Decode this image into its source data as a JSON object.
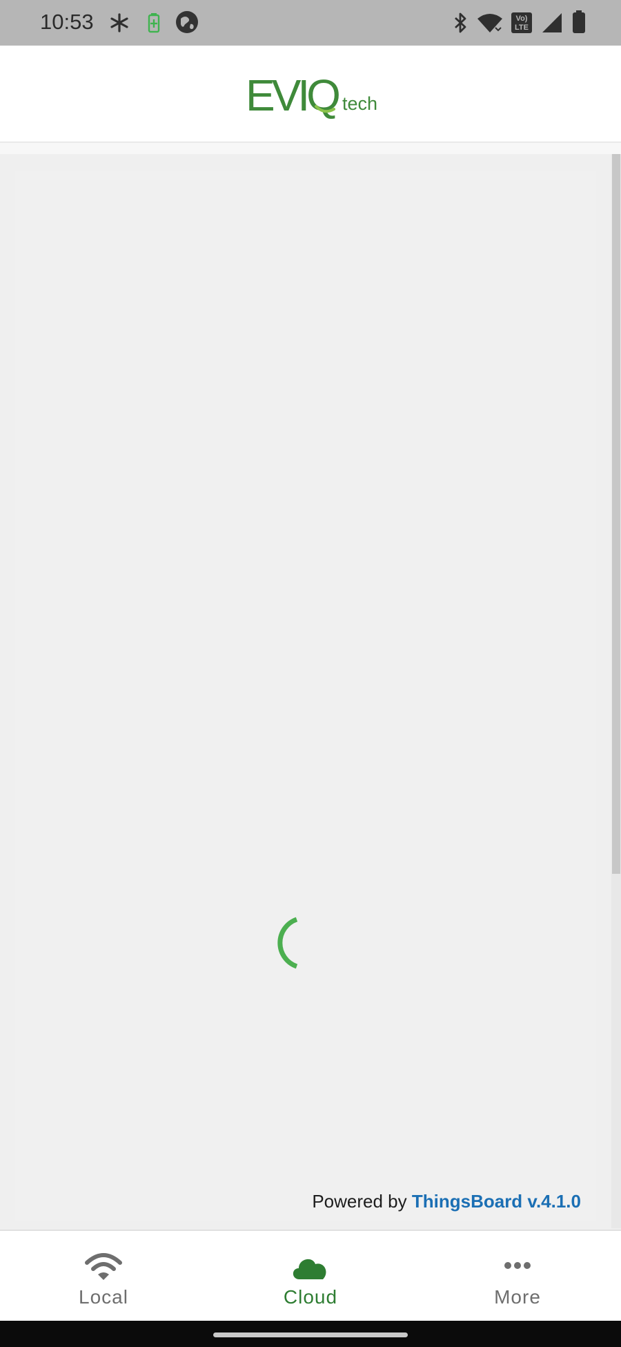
{
  "status_bar": {
    "time": "10:53",
    "left_icons": [
      "fan-icon",
      "battery-saver-icon",
      "vpn-globe-icon"
    ],
    "right_icons": [
      "bluetooth-icon",
      "wifi-icon",
      "volte-icon",
      "cell-signal-icon",
      "battery-icon"
    ],
    "volte_label_top": "Vo)",
    "volte_label_bottom": "LTE"
  },
  "header": {
    "logo_main": "EVIQ",
    "logo_sub": "tech",
    "brand_color": "#3f8a3a"
  },
  "content": {
    "loading_spinner": "spinner-icon",
    "spinner_color": "#4caf50",
    "powered_by_prefix": "Powered by ",
    "powered_by_link": "ThingsBoard v.4.1.0",
    "link_color": "#1b6fb4"
  },
  "bottom_nav": {
    "items": [
      {
        "label": "Local",
        "icon": "wifi-icon",
        "active": false
      },
      {
        "label": "Cloud",
        "icon": "cloud-icon",
        "active": true
      },
      {
        "label": "More",
        "icon": "more-dots-icon",
        "active": false
      }
    ],
    "active_color": "#2e7d32",
    "inactive_color": "#6e6e6e"
  }
}
